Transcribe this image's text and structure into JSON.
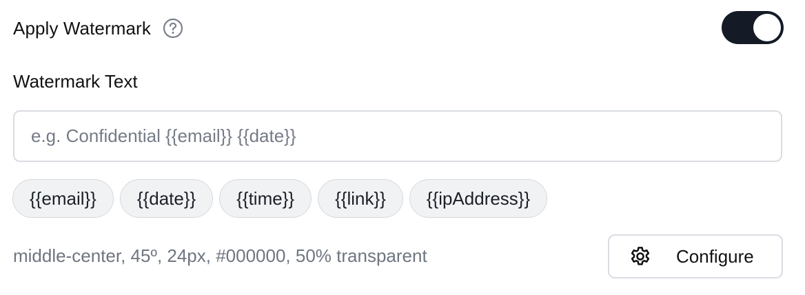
{
  "watermark": {
    "apply_label": "Apply Watermark",
    "help_icon": "question-circle-icon",
    "toggle_on": true,
    "text_label": "Watermark Text",
    "text_value": "",
    "text_placeholder": "e.g. Confidential {{email}} {{date}}",
    "chips": [
      "{{email}}",
      "{{date}}",
      "{{time}}",
      "{{link}}",
      "{{ipAddress}}"
    ],
    "summary": "middle-center, 45º, 24px, #000000, 50% transparent",
    "configure_label": "Configure",
    "configure_icon": "gear-icon"
  },
  "colors": {
    "toggle_on": "#141a26",
    "muted_text": "#6f7580",
    "chip_bg": "#f1f2f4",
    "border": "#d9dce1"
  }
}
